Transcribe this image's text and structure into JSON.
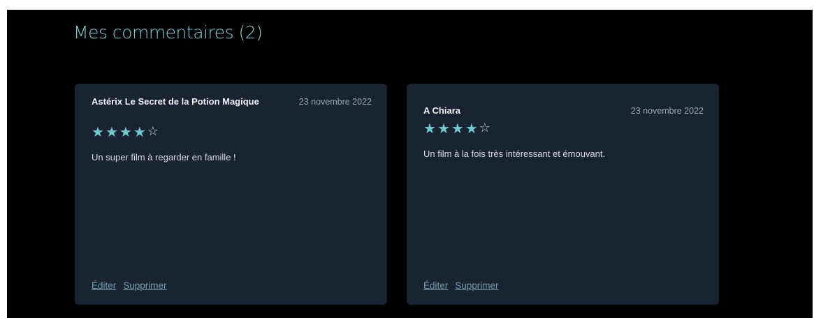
{
  "section": {
    "title": "Mes commentaires (2)"
  },
  "colors": {
    "background": "#000000",
    "card": "#1a2332",
    "accent": "#7ecfd6",
    "star": "#6fcad1",
    "link": "#6f9fb0"
  },
  "comments": [
    {
      "film_title": "Astérix   Le Secret de la Potion Magique",
      "date": "23 novembre 2022",
      "rating": 4,
      "rating_max": 5,
      "text": "Un super film à regarder en famille !",
      "edit_label": "Éditer",
      "delete_label": "Supprimer"
    },
    {
      "film_title": "A Chiara",
      "date": "23 novembre 2022",
      "rating": 4,
      "rating_max": 5,
      "text": "Un film à la fois très intéressant et émouvant.",
      "edit_label": "Éditer",
      "delete_label": "Supprimer"
    }
  ]
}
